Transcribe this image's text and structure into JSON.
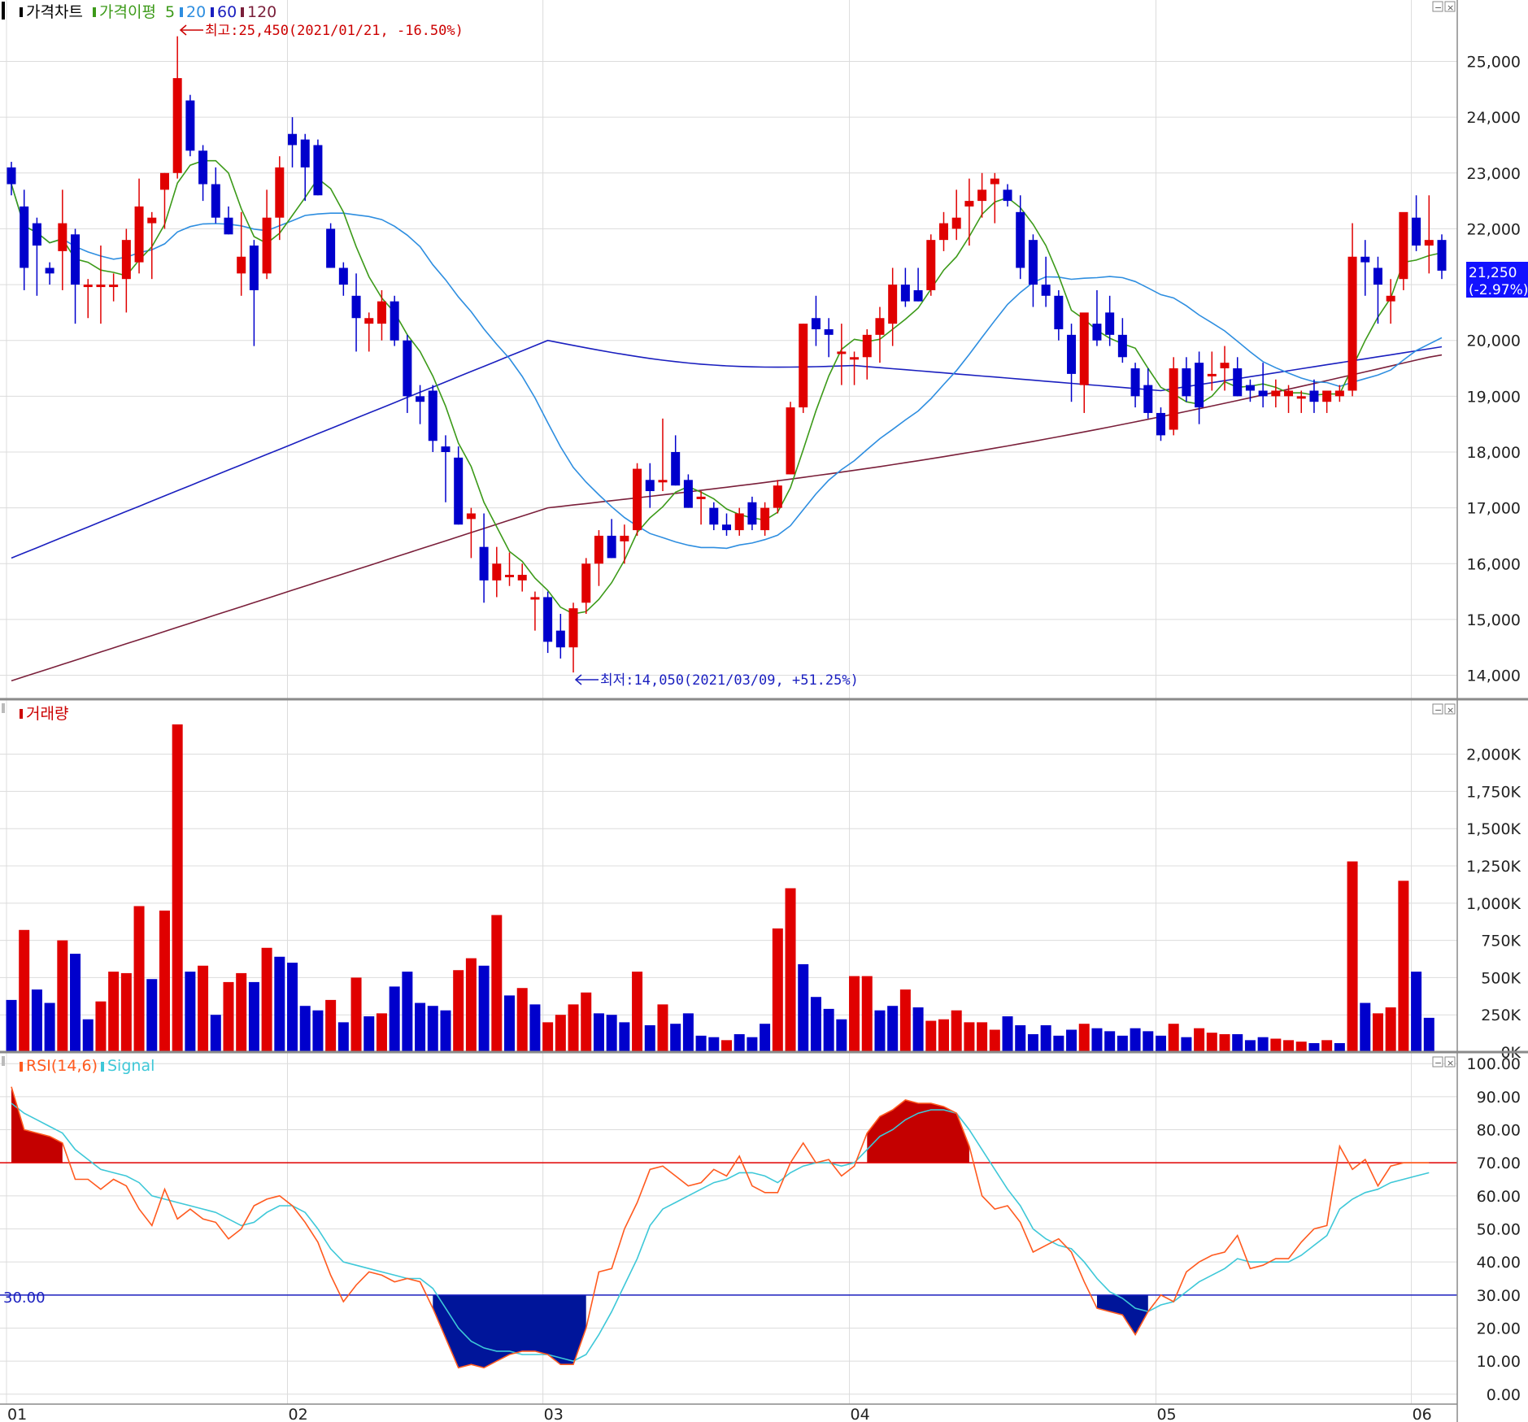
{
  "chart_data": [
    {
      "type": "candlestick",
      "panel": "price",
      "legend": [
        {
          "label": "가격차트",
          "color": "#000000"
        },
        {
          "label": "가격이평",
          "color": "#3c9a19"
        },
        {
          "label": "5",
          "color": "#3c9a19"
        },
        {
          "label": "20",
          "color": "#2e8ee0"
        },
        {
          "label": "60",
          "color": "#1a1fbf"
        },
        {
          "label": "120",
          "color": "#7a1f3a"
        }
      ],
      "y_ticks": [
        "25,000",
        "24,000",
        "23,000",
        "22,000",
        "21,000",
        "20,000",
        "19,000",
        "18,000",
        "17,000",
        "16,000",
        "15,000",
        "14,000"
      ],
      "y_tick_values": [
        25000,
        24000,
        23000,
        22000,
        21000,
        20000,
        19000,
        18000,
        17000,
        16000,
        15000,
        14000
      ],
      "ylim": [
        13600,
        26100
      ],
      "high_annotation": "최고:25,450(2021/01/21, -16.50%)",
      "low_annotation": "최저:14,050(2021/03/09, +51.25%)",
      "current_price": "21,250",
      "current_change": "(-2.97%)",
      "up_color": "#e00000",
      "down_color": "#0000cc",
      "candles": [
        [
          23100,
          23200,
          22600,
          22800
        ],
        [
          22400,
          22700,
          20900,
          21300
        ],
        [
          22100,
          22200,
          20800,
          21700
        ],
        [
          21300,
          21400,
          21000,
          21200
        ],
        [
          21600,
          22700,
          20900,
          22100
        ],
        [
          21900,
          22000,
          20300,
          21000
        ],
        [
          21000,
          21100,
          20400,
          21000
        ],
        [
          21000,
          21700,
          20300,
          21000
        ],
        [
          21000,
          21200,
          20700,
          21000
        ],
        [
          21100,
          22000,
          20500,
          21800
        ],
        [
          21400,
          22900,
          21200,
          22400
        ],
        [
          22100,
          22300,
          21100,
          22200
        ],
        [
          22700,
          23000,
          22000,
          23000
        ],
        [
          23000,
          25450,
          22900,
          24700
        ],
        [
          24300,
          24400,
          23300,
          23400
        ],
        [
          23400,
          23500,
          22500,
          22800
        ],
        [
          22800,
          23100,
          22100,
          22200
        ],
        [
          22200,
          22400,
          21900,
          21900
        ],
        [
          21200,
          22300,
          20800,
          21500
        ],
        [
          21700,
          21800,
          19900,
          20900
        ],
        [
          21200,
          22700,
          21100,
          22200
        ],
        [
          22200,
          23300,
          21800,
          23100
        ],
        [
          23700,
          24000,
          23100,
          23500
        ],
        [
          23600,
          23700,
          22500,
          23100
        ],
        [
          23500,
          23600,
          22600,
          22600
        ],
        [
          22000,
          22100,
          21300,
          21300
        ],
        [
          21300,
          21400,
          20800,
          21000
        ],
        [
          20800,
          21200,
          19800,
          20400
        ],
        [
          20300,
          20500,
          19800,
          20400
        ],
        [
          20300,
          20900,
          20000,
          20700
        ],
        [
          20700,
          20800,
          19900,
          20000
        ],
        [
          20000,
          20100,
          18700,
          19000
        ],
        [
          19000,
          19200,
          18500,
          18900
        ],
        [
          19100,
          19200,
          18000,
          18200
        ],
        [
          18100,
          18300,
          17100,
          18000
        ],
        [
          17900,
          18100,
          16700,
          16700
        ],
        [
          16800,
          17000,
          16100,
          16900
        ],
        [
          16300,
          16900,
          15300,
          15700
        ],
        [
          15700,
          16300,
          15400,
          16000
        ],
        [
          15800,
          16200,
          15600,
          15800
        ],
        [
          15700,
          16000,
          15500,
          15800
        ],
        [
          15400,
          15500,
          14800,
          15400
        ],
        [
          15400,
          15500,
          14400,
          14600
        ],
        [
          14800,
          15100,
          14300,
          14500
        ],
        [
          14500,
          15300,
          14050,
          15200
        ],
        [
          15300,
          16100,
          15100,
          16000
        ],
        [
          16000,
          16600,
          15600,
          16500
        ],
        [
          16500,
          16800,
          16100,
          16100
        ],
        [
          16400,
          16700,
          16000,
          16500
        ],
        [
          16600,
          17800,
          16500,
          17700
        ],
        [
          17500,
          17800,
          17000,
          17300
        ],
        [
          17500,
          18600,
          17300,
          17500
        ],
        [
          18000,
          18300,
          17400,
          17400
        ],
        [
          17500,
          17600,
          17000,
          17000
        ],
        [
          17200,
          17300,
          16700,
          17200
        ],
        [
          17000,
          17100,
          16600,
          16700
        ],
        [
          16700,
          16900,
          16500,
          16600
        ],
        [
          16600,
          17000,
          16500,
          16900
        ],
        [
          17100,
          17200,
          16600,
          16700
        ],
        [
          16600,
          17100,
          16500,
          17000
        ],
        [
          17000,
          17500,
          16900,
          17400
        ],
        [
          17600,
          18900,
          17600,
          18800
        ],
        [
          18800,
          20300,
          18700,
          20300
        ],
        [
          20400,
          20800,
          19900,
          20200
        ],
        [
          20200,
          20400,
          19700,
          20100
        ],
        [
          19800,
          20300,
          19200,
          19800
        ],
        [
          19700,
          19800,
          19200,
          19700
        ],
        [
          19700,
          20200,
          19300,
          20100
        ],
        [
          20100,
          20600,
          19600,
          20400
        ],
        [
          20300,
          21300,
          19900,
          21000
        ],
        [
          21000,
          21300,
          20600,
          20700
        ],
        [
          20900,
          21300,
          20700,
          20700
        ],
        [
          20900,
          21900,
          20800,
          21800
        ],
        [
          21800,
          22300,
          21600,
          22100
        ],
        [
          22000,
          22700,
          21800,
          22200
        ],
        [
          22400,
          22900,
          21700,
          22500
        ],
        [
          22500,
          23000,
          22200,
          22700
        ],
        [
          22800,
          23000,
          22100,
          22900
        ],
        [
          22700,
          22800,
          22400,
          22500
        ],
        [
          22300,
          22600,
          21100,
          21300
        ],
        [
          21800,
          21900,
          20600,
          21000
        ],
        [
          21000,
          21500,
          20600,
          20800
        ],
        [
          20800,
          20900,
          20000,
          20200
        ],
        [
          20100,
          20300,
          18900,
          19400
        ],
        [
          19200,
          20300,
          18700,
          20500
        ],
        [
          20300,
          20900,
          19900,
          20000
        ],
        [
          20500,
          20800,
          19900,
          20100
        ],
        [
          20100,
          20400,
          19600,
          19700
        ],
        [
          19500,
          19600,
          18800,
          19000
        ],
        [
          19200,
          19500,
          18600,
          18700
        ],
        [
          18700,
          18800,
          18200,
          18300
        ],
        [
          18400,
          19700,
          18300,
          19500
        ],
        [
          19500,
          19700,
          18900,
          19000
        ],
        [
          19600,
          19800,
          18500,
          18800
        ],
        [
          19400,
          19800,
          19100,
          19400
        ],
        [
          19500,
          19900,
          19100,
          19600
        ],
        [
          19500,
          19700,
          19000,
          19000
        ],
        [
          19200,
          19300,
          18900,
          19100
        ],
        [
          19100,
          19600,
          18800,
          19000
        ],
        [
          19000,
          19300,
          18800,
          19100
        ],
        [
          19000,
          19200,
          18700,
          19100
        ],
        [
          19000,
          19100,
          18700,
          19000
        ],
        [
          19100,
          19300,
          18700,
          18900
        ],
        [
          18900,
          19000,
          18700,
          19100
        ],
        [
          19000,
          19200,
          18900,
          19100
        ],
        [
          19100,
          22100,
          19000,
          21500
        ],
        [
          21500,
          21800,
          20800,
          21400
        ],
        [
          21300,
          21500,
          20300,
          21000
        ],
        [
          20700,
          21100,
          20300,
          20800
        ],
        [
          21100,
          22000,
          20900,
          22300
        ],
        [
          22200,
          22600,
          21600,
          21700
        ],
        [
          21700,
          22600,
          21200,
          21800
        ],
        [
          21800,
          21900,
          21100,
          21250
        ]
      ]
    },
    {
      "type": "bar",
      "panel": "volume",
      "legend": [
        {
          "label": "거래량",
          "color": "#cc0000"
        }
      ],
      "y_ticks": [
        "2,000K",
        "1,750K",
        "1,500K",
        "1,250K",
        "1,000K",
        "750K",
        "500K",
        "250K",
        "0K"
      ],
      "y_tick_values": [
        2000,
        1750,
        1500,
        1250,
        1000,
        750,
        500,
        250,
        0
      ],
      "ylim": [
        0,
        2260
      ],
      "unit": "K",
      "up_color": "#e00000",
      "down_color": "#0000cc",
      "values": [
        350,
        820,
        420,
        330,
        750,
        660,
        220,
        340,
        540,
        530,
        980,
        490,
        950,
        2200,
        540,
        580,
        250,
        470,
        530,
        470,
        700,
        640,
        600,
        310,
        280,
        350,
        200,
        500,
        240,
        260,
        440,
        540,
        330,
        310,
        280,
        550,
        630,
        580,
        920,
        380,
        430,
        320,
        200,
        250,
        320,
        400,
        260,
        250,
        200,
        540,
        180,
        320,
        190,
        260,
        110,
        100,
        80,
        120,
        100,
        190,
        830,
        1100,
        590,
        370,
        290,
        220,
        510,
        510,
        280,
        310,
        420,
        300,
        210,
        220,
        280,
        200,
        200,
        150,
        240,
        180,
        120,
        180,
        110,
        150,
        190,
        160,
        140,
        110,
        160,
        140,
        110,
        190,
        100,
        160,
        130,
        120,
        120,
        80,
        100,
        90,
        80,
        70,
        60,
        80,
        60,
        1280,
        330,
        260,
        300,
        1150,
        540,
        230
      ],
      "directions": [
        "d",
        "u",
        "d",
        "d",
        "u",
        "d",
        "d",
        "u",
        "u",
        "u",
        "u",
        "d",
        "u",
        "u",
        "d",
        "u",
        "d",
        "u",
        "u",
        "d",
        "u",
        "d",
        "d",
        "d",
        "d",
        "u",
        "d",
        "u",
        "d",
        "u",
        "d",
        "d",
        "d",
        "d",
        "d",
        "u",
        "u",
        "d",
        "u",
        "d",
        "u",
        "d",
        "u",
        "u",
        "u",
        "u",
        "d",
        "d",
        "d",
        "u",
        "d",
        "u",
        "d",
        "d",
        "d",
        "d",
        "u",
        "d",
        "d",
        "d",
        "u",
        "u",
        "d",
        "d",
        "d",
        "d",
        "u",
        "u",
        "d",
        "d",
        "u",
        "d",
        "u",
        "u",
        "u",
        "u",
        "u",
        "u",
        "d",
        "d",
        "d",
        "d",
        "d",
        "d",
        "u",
        "d",
        "d",
        "d",
        "d",
        "d",
        "d",
        "u",
        "d",
        "u",
        "u",
        "u",
        "d",
        "d",
        "d",
        "u",
        "u",
        "u",
        "d",
        "u",
        "d",
        "u",
        "d",
        "u",
        "u",
        "u",
        "d",
        "d"
      ]
    },
    {
      "type": "line",
      "panel": "rsi",
      "legend": [
        {
          "label": "RSI(14,6)",
          "color": "#ff5a1f"
        },
        {
          "label": "Signal",
          "color": "#3ec8d8"
        }
      ],
      "y_ticks": [
        "100.00",
        "90.00",
        "80.00",
        "70.00",
        "60.00",
        "50.00",
        "40.00",
        "30.00",
        "20.00",
        "10.00",
        "0.00"
      ],
      "y_tick_values": [
        100,
        90,
        80,
        70,
        60,
        50,
        40,
        30,
        20,
        10,
        0
      ],
      "ylim": [
        -3,
        103
      ],
      "upper_level": 70,
      "lower_level": 30,
      "lower_level_label": "30.00",
      "rsi": [
        93,
        80,
        79,
        78,
        76,
        65,
        65,
        62,
        65,
        63,
        56,
        51,
        62,
        53,
        56,
        53,
        52,
        47,
        50,
        57,
        59,
        60,
        57,
        52,
        46,
        36,
        28,
        33,
        37,
        36,
        34,
        35,
        34,
        26,
        17,
        8,
        9,
        8,
        10,
        12,
        13,
        13,
        12,
        9,
        9,
        20,
        37,
        38,
        50,
        58,
        68,
        69,
        66,
        63,
        64,
        68,
        66,
        72,
        63,
        61,
        61,
        70,
        76,
        70,
        71,
        66,
        69,
        79,
        84,
        86,
        89,
        88,
        88,
        87,
        85,
        75,
        60,
        56,
        57,
        52,
        43,
        45,
        47,
        43,
        34,
        26,
        25,
        24,
        18,
        25,
        30,
        28,
        37,
        40,
        42,
        43,
        48,
        38,
        39,
        41,
        41,
        46,
        50,
        51,
        75,
        68,
        71,
        63,
        69,
        70,
        70,
        70
      ],
      "signal": [
        88,
        85,
        83,
        81,
        79,
        74,
        71,
        68,
        67,
        66,
        64,
        60,
        59,
        58,
        57,
        56,
        55,
        53,
        51,
        52,
        55,
        57,
        57,
        55,
        50,
        44,
        40,
        39,
        38,
        37,
        36,
        35,
        35,
        32,
        26,
        20,
        16,
        14,
        13,
        13,
        12,
        12,
        12,
        11,
        10,
        12,
        18,
        25,
        33,
        41,
        51,
        56,
        58,
        60,
        62,
        64,
        65,
        67,
        67,
        66,
        64,
        67,
        69,
        70,
        70,
        69,
        70,
        74,
        78,
        80,
        83,
        85,
        86,
        86,
        85,
        80,
        74,
        68,
        62,
        57,
        50,
        47,
        45,
        44,
        40,
        35,
        31,
        29,
        26,
        25,
        27,
        28,
        31,
        34,
        36,
        38,
        41,
        40,
        40,
        40,
        40,
        42,
        45,
        48,
        56,
        59,
        61,
        62,
        64,
        65,
        66,
        67
      ]
    }
  ],
  "x_axis": {
    "labels": [
      "01",
      "02",
      "03",
      "04",
      "05",
      "06"
    ],
    "label_indices": [
      0,
      22,
      42,
      66,
      90,
      110
    ]
  },
  "panel_buttons": [
    "−",
    "×"
  ]
}
